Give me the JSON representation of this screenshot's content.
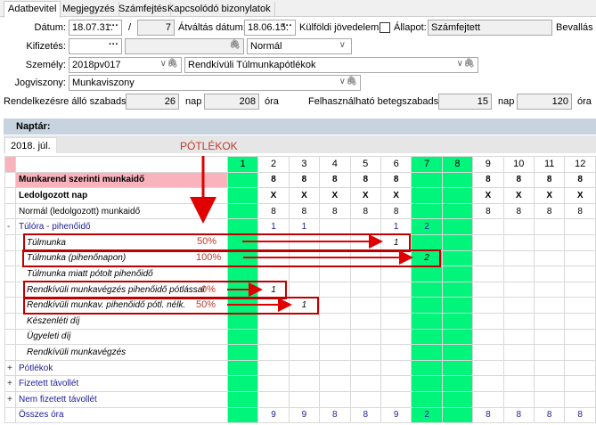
{
  "tabs": [
    "Adatbevitel",
    "Megjegyzés",
    "Számfejtés",
    "Kapcsolódó bizonylatok"
  ],
  "form": {
    "datum_label": "Dátum:",
    "datum": "18.07.31.",
    "slash": "/",
    "sorszam": "7",
    "atvaltas_label": "Átváltás dátum:",
    "atvaltas": "18.06.15.",
    "kulfoldi_label": "Külföldi jövedelem:",
    "kulfoldi_checked": false,
    "allapot_label": "Állapot:",
    "allapot": "Számfejtett",
    "bevallas_label": "Bevallás d",
    "kifizetes_label": "Kifizetés:",
    "kifizetes": "",
    "kifizetes2": "",
    "kifizetes_tipus": "Normál",
    "szemely_label": "Személy:",
    "szemely": "2018pv017",
    "szemely_tipus": "Rendkívüli Túlmunkapótlékok",
    "jogviszony_label": "Jogviszony:",
    "jogviszony": "Munkaviszony",
    "szabadsag_label": "Rendelkezésre álló szabadság:",
    "szabadsag_nap": "26",
    "nap": "nap",
    "szabadsag_ora": "208",
    "ora": "óra",
    "beteg_label": "Felhasználható betegszabadság:",
    "beteg_nap": "15",
    "beteg_ora": "120"
  },
  "calendar": {
    "title": "Naptár:",
    "month": "2018. júl.",
    "days": [
      "1",
      "2",
      "3",
      "4",
      "5",
      "6",
      "7",
      "8",
      "9",
      "10",
      "11",
      "12"
    ],
    "green_days": [
      1,
      7,
      8
    ],
    "rows": [
      {
        "marker": "",
        "label": "Munkarend szerinti munkaidő",
        "style": "pinkbold",
        "values": [
          "",
          "8",
          "8",
          "8",
          "8",
          "8",
          "",
          "",
          "8",
          "8",
          "8",
          "8"
        ]
      },
      {
        "marker": "",
        "label": "Ledolgozott nap",
        "style": "bold",
        "values": [
          "",
          "X",
          "X",
          "X",
          "X",
          "X",
          "",
          "",
          "X",
          "X",
          "X",
          "X"
        ]
      },
      {
        "marker": "",
        "label": "Normál (ledolgozott) munkaidő",
        "style": "",
        "values": [
          "",
          "8",
          "8",
          "8",
          "8",
          "8",
          "",
          "",
          "8",
          "8",
          "8",
          "8"
        ]
      },
      {
        "marker": "-",
        "label": "Túlóra - pihenőidő",
        "style": "blue",
        "values": [
          "",
          "1",
          "1",
          "",
          "",
          "1",
          "2",
          "",
          "",
          "",
          "",
          ""
        ]
      },
      {
        "marker": "",
        "label": "Túlmunka",
        "style": "italic",
        "values": [
          "",
          "",
          "",
          "",
          "",
          "1",
          "",
          "",
          "",
          "",
          "",
          ""
        ]
      },
      {
        "marker": "",
        "label": "Túlmunka (pihenőnapon)",
        "style": "italic",
        "values": [
          "",
          "",
          "",
          "",
          "",
          "",
          "2",
          "",
          "",
          "",
          "",
          ""
        ]
      },
      {
        "marker": "",
        "label": "Túlmunka miatt pótolt pihenőidő",
        "style": "italic",
        "values": [
          "",
          "",
          "",
          "",
          "",
          "",
          "",
          "",
          "",
          "",
          "",
          ""
        ]
      },
      {
        "marker": "",
        "label": "Rendkívüli munkavégzés pihenőidő pótlással",
        "style": "italic",
        "values": [
          "",
          "1",
          "",
          "",
          "",
          "",
          "",
          "",
          "",
          "",
          "",
          ""
        ]
      },
      {
        "marker": "",
        "label": "Rendkívüli munkav. pihenőidő pótl. nélk.",
        "style": "italic",
        "values": [
          "",
          "",
          "1",
          "",
          "",
          "",
          "",
          "",
          "",
          "",
          "",
          ""
        ]
      },
      {
        "marker": "",
        "label": "Készenléti díj",
        "style": "italic",
        "values": [
          "",
          "",
          "",
          "",
          "",
          "",
          "",
          "",
          "",
          "",
          "",
          ""
        ]
      },
      {
        "marker": "",
        "label": "Ügyeleti díj",
        "style": "italic",
        "values": [
          "",
          "",
          "",
          "",
          "",
          "",
          "",
          "",
          "",
          "",
          "",
          ""
        ]
      },
      {
        "marker": "",
        "label": "Rendkívüli munkavégzés",
        "style": "italic",
        "values": [
          "",
          "",
          "",
          "",
          "",
          "",
          "",
          "",
          "",
          "",
          "",
          ""
        ]
      },
      {
        "marker": "+",
        "label": "Pótlékok",
        "style": "blue",
        "values": [
          "",
          "",
          "",
          "",
          "",
          "",
          "",
          "",
          "",
          "",
          "",
          ""
        ]
      },
      {
        "marker": "+",
        "label": "Fizetett távollét",
        "style": "blue",
        "values": [
          "",
          "",
          "",
          "",
          "",
          "",
          "",
          "",
          "",
          "",
          "",
          ""
        ]
      },
      {
        "marker": "+",
        "label": "Nem fizetett távollét",
        "style": "blue",
        "values": [
          "",
          "",
          "",
          "",
          "",
          "",
          "",
          "",
          "",
          "",
          "",
          ""
        ]
      },
      {
        "marker": "",
        "label": "Összes óra",
        "style": "blue",
        "values": [
          "",
          "9",
          "9",
          "8",
          "8",
          "9",
          "2",
          "",
          "8",
          "8",
          "8",
          "8"
        ]
      }
    ]
  },
  "annotations": {
    "title": "PÓTLÉKOK",
    "pct": [
      "50%",
      "100%",
      "0%",
      "50%"
    ],
    "color": "#d40000"
  }
}
